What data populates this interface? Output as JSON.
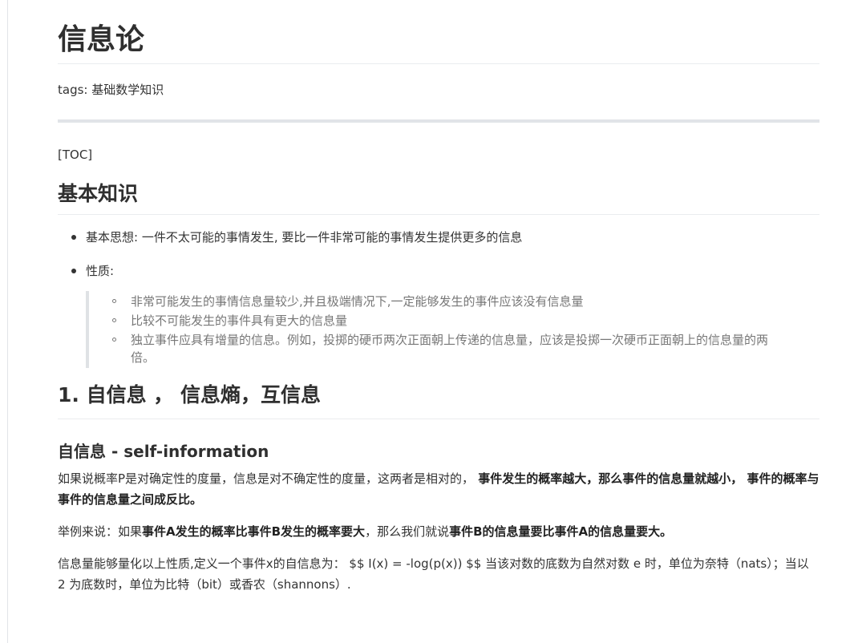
{
  "doc": {
    "title": "信息论",
    "tags": "tags: 基础数学知识",
    "toc": "[TOC]"
  },
  "basics": {
    "heading": "基本知识",
    "bullet_idea": "基本思想: 一件不太可能的事情发生, 要比一件非常可能的事情发生提供更多的信息",
    "bullet_props": "性质:",
    "props": [
      "非常可能发生的事情信息量较少,并且极端情况下,一定能够发生的事件应该没有信息量",
      "比较不可能发生的事件具有更大的信息量",
      "独立事件应具有增量的信息。例如，投掷的硬币两次正面朝上传递的信息量，应该是投掷一次硬币正面朝上的信息量的两倍。"
    ]
  },
  "section1": {
    "heading": "1. 自信息 ， 信息熵，互信息",
    "sub_heading_cn": "自信息",
    "sub_heading_en": " - self-information",
    "p1_a": "如果说概率P是对确定性的度量，信息是对不确定性的度量，这两者是相对的，",
    "p1_b": " 事件发生的概率越大，那么事件的信息量就越小，",
    "p1_c": " 事件的概率与事件的信息量之间成反比。",
    "p2_a": "举例来说：如果",
    "p2_b": "事件A发生的概率比事件B发生的概率要大",
    "p2_c": "，那么我们就说",
    "p2_d": "事件B的信息量要比事件A的信息量要大。",
    "p3": "信息量能够量化以上性质,定义一个事件x的自信息为： $$ I(x) = -log(p(x)) $$ 当该对数的底数为自然对数 e 时，单位为奈特（nats）；当以 2 为底数时，单位为比特（bit）或香农（shannons）."
  }
}
